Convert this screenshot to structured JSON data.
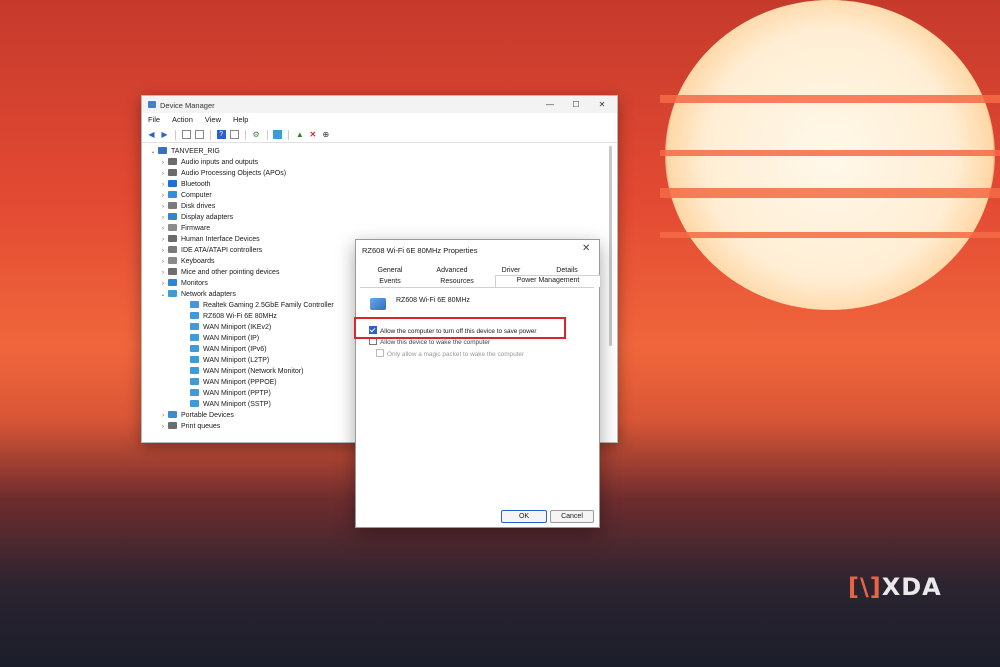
{
  "device_manager": {
    "title": "Device Manager",
    "window_controls": {
      "minimize": "—",
      "maximize": "☐",
      "close": "✕"
    },
    "menu": [
      "File",
      "Action",
      "View",
      "Help"
    ],
    "tree": [
      {
        "label": "TANVEER_RIG",
        "level": 0,
        "expanded": true,
        "icon_color": "#3a6fc4"
      },
      {
        "label": "Audio inputs and outputs",
        "level": 1,
        "expanded": false,
        "icon_color": "#6b6b6b"
      },
      {
        "label": "Audio Processing Objects (APOs)",
        "level": 1,
        "expanded": false,
        "icon_color": "#6b6b6b"
      },
      {
        "label": "Bluetooth",
        "level": 1,
        "expanded": false,
        "icon_color": "#1f6fd6"
      },
      {
        "label": "Computer",
        "level": 1,
        "expanded": false,
        "icon_color": "#3a8ad6"
      },
      {
        "label": "Disk drives",
        "level": 1,
        "expanded": false,
        "icon_color": "#7b7b7b"
      },
      {
        "label": "Display adapters",
        "level": 1,
        "expanded": false,
        "icon_color": "#2f86c8"
      },
      {
        "label": "Firmware",
        "level": 1,
        "expanded": false,
        "icon_color": "#8c8c8c"
      },
      {
        "label": "Human Interface Devices",
        "level": 1,
        "expanded": false,
        "icon_color": "#6c6c6c"
      },
      {
        "label": "IDE ATA/ATAPI controllers",
        "level": 1,
        "expanded": false,
        "icon_color": "#7a7a7a"
      },
      {
        "label": "Keyboards",
        "level": 1,
        "expanded": false,
        "icon_color": "#8a8a8a"
      },
      {
        "label": "Mice and other pointing devices",
        "level": 1,
        "expanded": false,
        "icon_color": "#6e6e6e"
      },
      {
        "label": "Monitors",
        "level": 1,
        "expanded": false,
        "icon_color": "#2f86c8"
      },
      {
        "label": "Network adapters",
        "level": 1,
        "expanded": true,
        "icon_color": "#3f9bd8"
      },
      {
        "label": "Realtek Gaming 2.5GbE Family Controller",
        "level": 2,
        "icon_color": "#3f9bd8"
      },
      {
        "label": "RZ608 Wi-Fi 6E 80MHz",
        "level": 2,
        "icon_color": "#3f9bd8"
      },
      {
        "label": "WAN Miniport (IKEv2)",
        "level": 2,
        "icon_color": "#3f9bd8"
      },
      {
        "label": "WAN Miniport (IP)",
        "level": 2,
        "icon_color": "#3f9bd8"
      },
      {
        "label": "WAN Miniport (IPv6)",
        "level": 2,
        "icon_color": "#3f9bd8"
      },
      {
        "label": "WAN Miniport (L2TP)",
        "level": 2,
        "icon_color": "#3f9bd8"
      },
      {
        "label": "WAN Miniport (Network Monitor)",
        "level": 2,
        "icon_color": "#3f9bd8"
      },
      {
        "label": "WAN Miniport (PPPOE)",
        "level": 2,
        "icon_color": "#3f9bd8"
      },
      {
        "label": "WAN Miniport (PPTP)",
        "level": 2,
        "icon_color": "#3f9bd8"
      },
      {
        "label": "WAN Miniport (SSTP)",
        "level": 2,
        "icon_color": "#3f9bd8"
      },
      {
        "label": "Portable Devices",
        "level": 1,
        "expanded": false,
        "icon_color": "#3a8ad6"
      },
      {
        "label": "Print queues",
        "level": 1,
        "expanded": false,
        "icon_color": "#6e6e6e"
      }
    ]
  },
  "properties_dialog": {
    "title": "RZ608 Wi-Fi 6E 80MHz Properties",
    "close_glyph": "✕",
    "tabs": {
      "general": "General",
      "advanced": "Advanced",
      "driver": "Driver",
      "details": "Details",
      "events": "Events",
      "resources": "Resources",
      "power_management": "Power Management"
    },
    "device_name": "RZ608 Wi-Fi 6E 80MHz",
    "options": {
      "allow_turn_off": "Allow the computer to turn off this device to save power",
      "allow_wake": "Allow this device to wake the computer",
      "magic_packet": "Only allow a magic packet to wake the computer"
    },
    "ok_label": "OK",
    "cancel_label": "Cancel"
  },
  "watermark": {
    "bracket": "[\\]",
    "text": "XDA"
  },
  "colors": {
    "highlight": "#d9262b",
    "accent": "#2a62c9"
  }
}
